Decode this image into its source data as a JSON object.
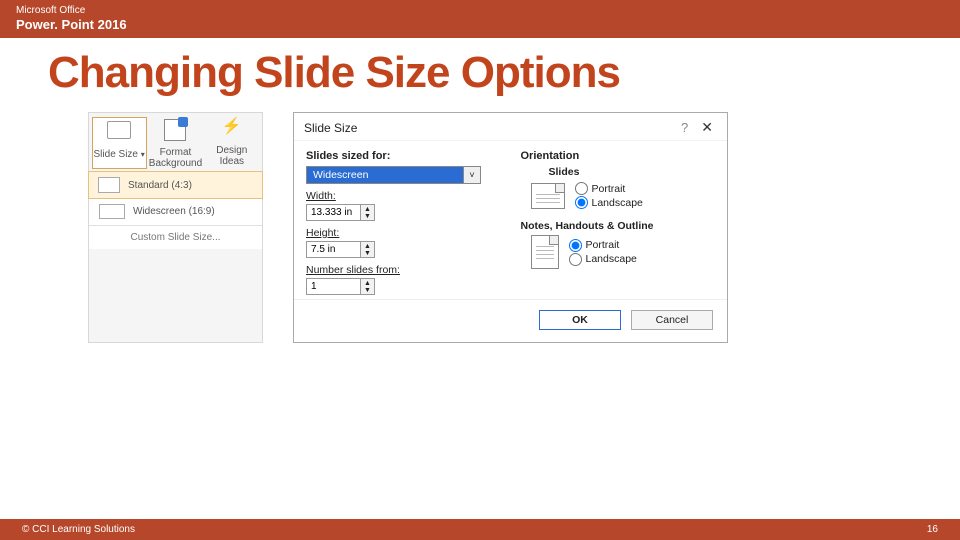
{
  "header": {
    "suite": "Microsoft Office",
    "product": "Power. Point 2016"
  },
  "title": "Changing Slide Size Options",
  "ribbon": {
    "buttons": [
      {
        "label": "Slide Size"
      },
      {
        "label": "Format Background"
      },
      {
        "label": "Design Ideas"
      }
    ],
    "menu": {
      "standard": "Standard (4:3)",
      "widescreen": "Widescreen (16:9)",
      "custom": "Custom Slide Size..."
    }
  },
  "dialog": {
    "title": "Slide Size",
    "left": {
      "sized_for_label": "Slides sized for:",
      "sized_for_value": "Widescreen",
      "width_label": "Width:",
      "width_value": "13.333 in",
      "height_label": "Height:",
      "height_value": "7.5 in",
      "number_label": "Number slides from:",
      "number_value": "1"
    },
    "right": {
      "orientation": "Orientation",
      "slides": "Slides",
      "slides_portrait": "Portrait",
      "slides_landscape": "Landscape",
      "notes_head": "Notes, Handouts & Outline",
      "notes_portrait": "Portrait",
      "notes_landscape": "Landscape"
    },
    "buttons": {
      "ok": "OK",
      "cancel": "Cancel"
    }
  },
  "footer": {
    "copyright": "© CCI Learning Solutions",
    "page": "16"
  }
}
